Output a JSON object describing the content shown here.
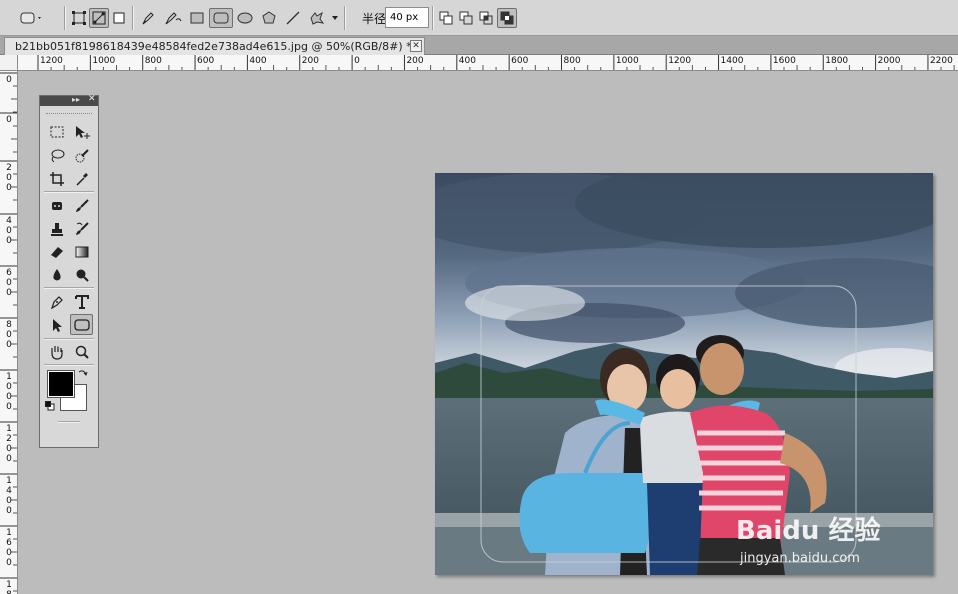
{
  "options_bar": {
    "radius_label": "半径:",
    "radius_value": "40 px",
    "tools": [
      "rounded-rect-preset-icon",
      "shape-layers-icon",
      "paths-icon",
      "fill-pixels-icon",
      "pen-icon",
      "freeform-pen-icon",
      "rectangle-icon",
      "rounded-rectangle-icon",
      "ellipse-icon",
      "polygon-icon",
      "line-icon",
      "custom-shape-icon",
      "dropdown-arrow-icon"
    ],
    "combine_modes": [
      "add-shape-icon",
      "subtract-shape-icon",
      "intersect-shape-icon",
      "exclude-shape-icon"
    ]
  },
  "document": {
    "tab_title": "b21bb051f8198618439e48584fed2e738ad4e615.jpg @ 50%(RGB/8#) *",
    "close_label": "✕"
  },
  "rulers": {
    "horizontal_labels": [
      "1200",
      "1000",
      "800",
      "600",
      "400",
      "200",
      "0",
      "200",
      "400",
      "600",
      "800",
      "1000",
      "1200",
      "1400",
      "1600",
      "1800",
      "2000",
      "2200"
    ],
    "vertical_labels": [
      "0",
      "0",
      "200",
      "400",
      "600",
      "800",
      "1000",
      "1200",
      "1400",
      "1600",
      "1800"
    ]
  },
  "tool_panel": {
    "collapse_label": "▸▸",
    "close_label": "✕",
    "tools": [
      "marquee-icon",
      "move-icon",
      "lasso-icon",
      "quick-selection-icon",
      "crop-icon",
      "eyedropper-icon",
      "spot-healing-icon",
      "brush-icon",
      "clone-stamp-icon",
      "history-brush-icon",
      "eraser-icon",
      "gradient-icon",
      "blur-icon",
      "dodge-icon",
      "pen-tool-icon",
      "type-icon",
      "path-selection-icon",
      "rounded-rectangle-tool-icon",
      "hand-icon",
      "zoom-icon"
    ],
    "foreground_color": "#000000",
    "background_color": "#ffffff",
    "active_tool": "rounded-rectangle-tool-icon"
  },
  "watermark": {
    "brand": "Baidu 经验",
    "url": "jingyan.baidu.com"
  }
}
